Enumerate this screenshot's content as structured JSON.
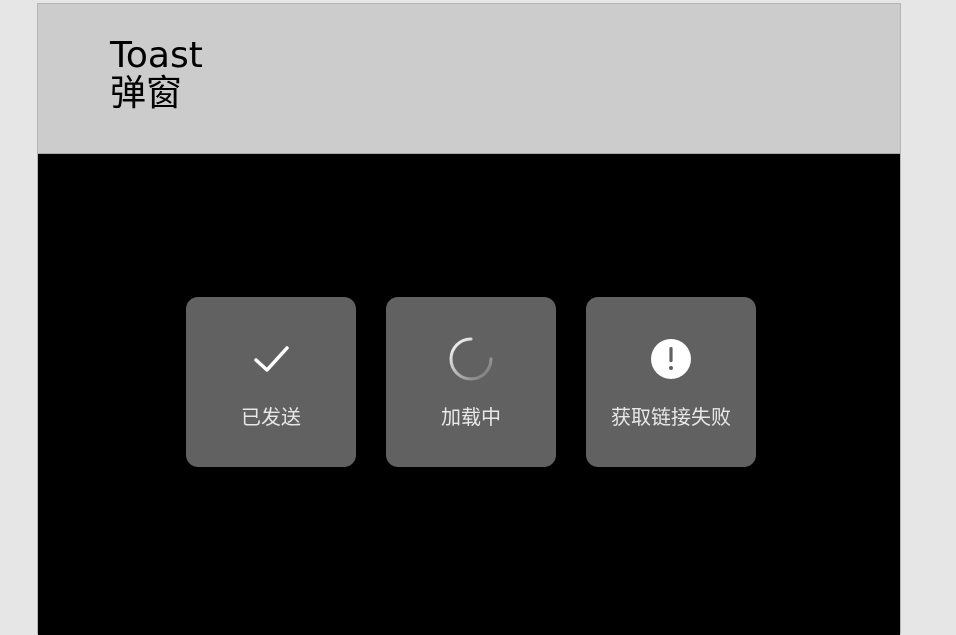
{
  "header": {
    "title_line1": "Toast",
    "title_line2": "弹窗"
  },
  "toasts": [
    {
      "icon": "check-icon",
      "label": "已发送"
    },
    {
      "icon": "spinner-icon",
      "label": "加载中"
    },
    {
      "icon": "exclamation-circle-icon",
      "label": "获取链接失败"
    }
  ],
  "colors": {
    "header_bg": "#cccccc",
    "stage_bg": "#000000",
    "toast_bg": "#616161",
    "toast_text": "#e8e8e8"
  }
}
